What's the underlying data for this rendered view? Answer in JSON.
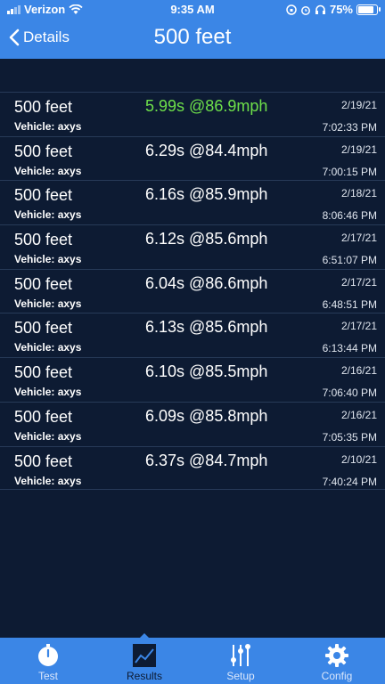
{
  "status_bar": {
    "carrier": "Verizon",
    "time": "9:35 AM",
    "battery": "75%",
    "battery_level": 0.75
  },
  "nav": {
    "back_label": "Details",
    "title": "500 feet"
  },
  "results": [
    {
      "distance": "500 feet",
      "vehicle": "Vehicle: axys",
      "result": "5.99s @86.9mph",
      "date": "2/19/21",
      "time": "7:02:33 PM",
      "best": true
    },
    {
      "distance": "500 feet",
      "vehicle": "Vehicle: axys",
      "result": "6.29s @84.4mph",
      "date": "2/19/21",
      "time": "7:00:15 PM",
      "best": false
    },
    {
      "distance": "500 feet",
      "vehicle": "Vehicle: axys",
      "result": "6.16s @85.9mph",
      "date": "2/18/21",
      "time": "8:06:46 PM",
      "best": false
    },
    {
      "distance": "500 feet",
      "vehicle": "Vehicle: axys",
      "result": "6.12s @85.6mph",
      "date": "2/17/21",
      "time": "6:51:07 PM",
      "best": false
    },
    {
      "distance": "500 feet",
      "vehicle": "Vehicle: axys",
      "result": "6.04s @86.6mph",
      "date": "2/17/21",
      "time": "6:48:51 PM",
      "best": false
    },
    {
      "distance": "500 feet",
      "vehicle": "Vehicle: axys",
      "result": "6.13s @85.6mph",
      "date": "2/17/21",
      "time": "6:13:44 PM",
      "best": false
    },
    {
      "distance": "500 feet",
      "vehicle": "Vehicle: axys",
      "result": "6.10s @85.5mph",
      "date": "2/16/21",
      "time": "7:06:40 PM",
      "best": false
    },
    {
      "distance": "500 feet",
      "vehicle": "Vehicle: axys",
      "result": "6.09s @85.8mph",
      "date": "2/16/21",
      "time": "7:05:35 PM",
      "best": false
    },
    {
      "distance": "500 feet",
      "vehicle": "Vehicle: axys",
      "result": "6.37s @84.7mph",
      "date": "2/10/21",
      "time": "7:40:24 PM",
      "best": false
    }
  ],
  "tabs": [
    {
      "label": "Test",
      "icon": "stopwatch-icon"
    },
    {
      "label": "Results",
      "icon": "chart-icon",
      "active": true
    },
    {
      "label": "Setup",
      "icon": "sliders-icon"
    },
    {
      "label": "Config",
      "icon": "gear-icon"
    }
  ],
  "colors": {
    "accent": "#3b86e6",
    "background": "#0d1b33",
    "best_result": "#6ee04a"
  }
}
